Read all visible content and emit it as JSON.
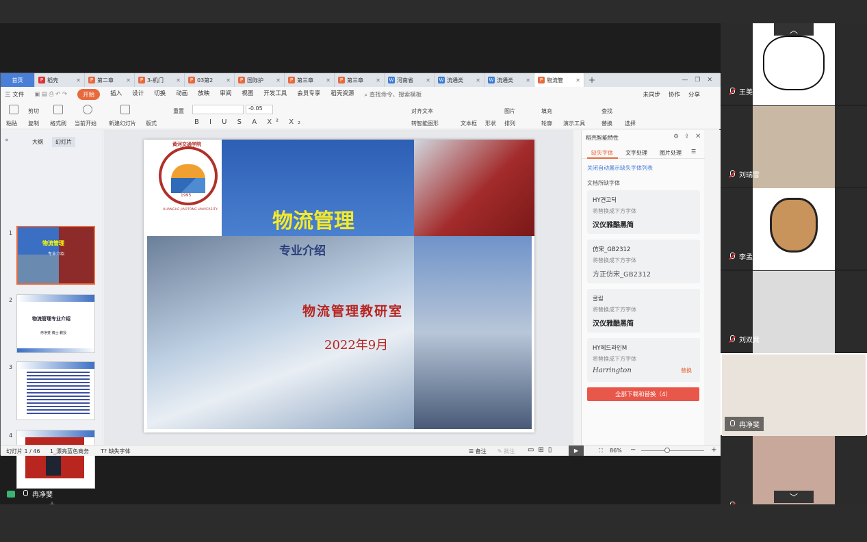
{
  "tabs": [
    {
      "label": "首页",
      "type": "home"
    },
    {
      "label": "稻壳",
      "color": "#d33"
    },
    {
      "label": "第二章",
      "color": "#e86a3c"
    },
    {
      "label": "3-机门",
      "color": "#e86a3c"
    },
    {
      "label": "03第2",
      "color": "#e86a3c"
    },
    {
      "label": "国际护",
      "color": "#e86a3c"
    },
    {
      "label": "第三章",
      "color": "#e86a3c"
    },
    {
      "label": "第三章",
      "color": "#e86a3c"
    },
    {
      "label": "河南省",
      "color": "#3a7bd5"
    },
    {
      "label": "流通类",
      "color": "#3a7bd5"
    },
    {
      "label": "流通类",
      "color": "#3a7bd5"
    },
    {
      "label": "物流管",
      "color": "#e86a3c",
      "active": true
    }
  ],
  "menu": {
    "file": "三 文件",
    "items": [
      "开始",
      "插入",
      "设计",
      "切换",
      "动画",
      "放映",
      "审阅",
      "视图",
      "开发工具",
      "会员专享",
      "稻壳资源"
    ],
    "search": "查找命令、搜索模板",
    "sync": "未同步",
    "collab": "协作",
    "share": "分享"
  },
  "ribbon": {
    "paste": "粘贴",
    "cut": "剪切",
    "copy": "复制",
    "format_painter": "格式刷",
    "start_show": "当前开始",
    "new_slide": "新建幻灯片",
    "layout": "版式",
    "reset": "重置",
    "font_size": "-0.05",
    "align_text": "对齐文本",
    "convert": "转智能图形",
    "textbox": "文本框",
    "shape": "形状",
    "arrange": "排列",
    "outline": "轮廓",
    "image": "图片",
    "fill": "填充",
    "present_tool": "演示工具",
    "find": "查找",
    "replace": "替换",
    "select": "选择"
  },
  "leftpane": {
    "tab_outline": "大纲",
    "tab_slides": "幻灯片",
    "thumbs": [
      {
        "num": "1",
        "title": "物流管理",
        "sub": "专业介绍"
      },
      {
        "num": "2",
        "title": "物流管理专业介绍",
        "sub": "冉净斐 博士 教授"
      },
      {
        "num": "3",
        "title": "",
        "sub": ""
      },
      {
        "num": "4",
        "title": "",
        "sub": ""
      }
    ]
  },
  "slide": {
    "title": "物流管理",
    "subtitle": "专业介绍",
    "dept": "物流管理教研室",
    "date": "2022年9月",
    "logo_text": "HUANGHE JIAOTONG UNIVERSITY",
    "logo_cn": "黄河交通学院",
    "logo_year": "1995"
  },
  "rpanel": {
    "title": "稻壳智能特性",
    "tabs": [
      "缺失字体",
      "文字处理",
      "图片处理"
    ],
    "link": "关闭自动展示缺失字体列表",
    "section": "文档所缺字体",
    "cards": [
      {
        "name": "HY견고딕",
        "hint": "将替换成下方字体",
        "font": "汉仪雅酷黑简"
      },
      {
        "name": "仿宋_GB2312",
        "hint": "将替换成下方字体",
        "font": "方正仿宋_GB2312"
      },
      {
        "name": "굴림",
        "hint": "将替换成下方字体",
        "font": "汉仪雅酷黑简"
      },
      {
        "name": "HY헤드라인M",
        "hint": "将替换成下方字体",
        "font": "Harrington",
        "action": "替换"
      }
    ],
    "download_btn": "全部下载和替换（4）"
  },
  "status": {
    "slide": "幻灯片 1 / 46",
    "theme": "1_漂亮蓝色商务",
    "missing": "缺失字体",
    "notes": "备注",
    "comment": "批注",
    "zoom": "86%"
  },
  "participants": [
    {
      "name": "王美晨",
      "muted": true,
      "bg": "#ffffff"
    },
    {
      "name": "刘瑞雪",
      "muted": true,
      "bg": "#c9b8a4"
    },
    {
      "name": "李孟想",
      "muted": true,
      "bg": "#ffffff"
    },
    {
      "name": "刘双萁",
      "muted": true,
      "bg": "#dcdcdc"
    },
    {
      "name": "冉净斐",
      "muted": false,
      "bg": "#e9e3dc"
    },
    {
      "name": "",
      "muted": true,
      "bg": "#c8a89a"
    }
  ],
  "bottom": {
    "speaker": "冉净斐"
  }
}
